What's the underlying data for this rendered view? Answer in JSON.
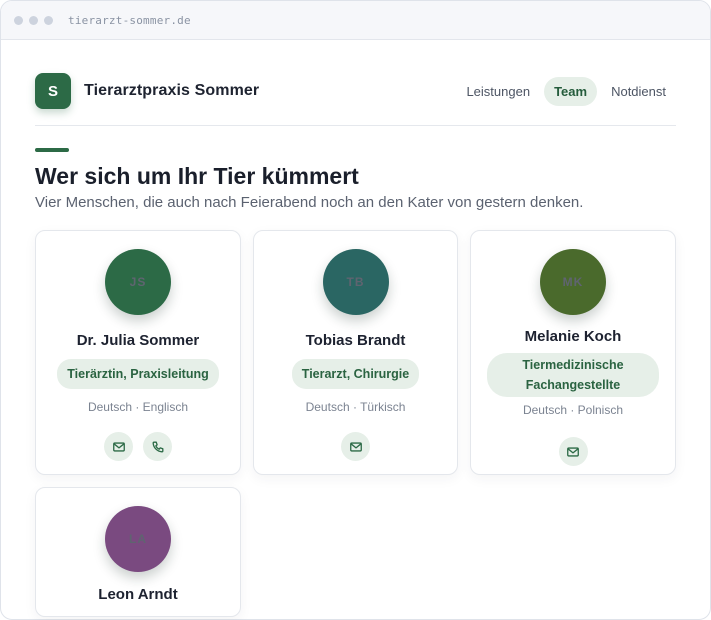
{
  "browser": {
    "url": "tierarzt-sommer.de"
  },
  "brand": {
    "logo_letter": "S",
    "name": "Tierarztpraxis Sommer"
  },
  "nav": {
    "items": [
      "Leistungen",
      "Team",
      "Notdienst"
    ],
    "active": "Team"
  },
  "section": {
    "title": "Wer sich um Ihr Tier kümmert",
    "subtitle": "Vier Menschen, die auch nach Feierabend noch an den Kater von gestern denken."
  },
  "team": [
    {
      "initials": "JS",
      "name": "Dr. Julia Sommer",
      "role": "Tierärztin, Praxisleitung",
      "languages": "Deutsch · Englisch",
      "avatar_color": "#2c6a46",
      "actions": [
        "mail-icon",
        "phone-icon"
      ]
    },
    {
      "initials": "TB",
      "name": "Tobias Brandt",
      "role": "Tierarzt, Chirurgie",
      "languages": "Deutsch · Türkisch",
      "avatar_color": "#2a6663",
      "actions": [
        "mail-icon"
      ]
    },
    {
      "initials": "MK",
      "name": "Melanie Koch",
      "role": "Tiermedizinische Fachangestellte",
      "languages": "Deutsch · Polnisch",
      "avatar_color": "#4a6a2c",
      "actions": [
        "mail-icon"
      ]
    },
    {
      "initials": "LA",
      "name": "Leon Arndt",
      "role": "",
      "languages": "",
      "avatar_color": "#7a4a80",
      "actions": []
    }
  ],
  "colors": {
    "accent": "#2c6a46",
    "accent_soft": "#e6efe8",
    "initials_text": "#5f6470"
  }
}
